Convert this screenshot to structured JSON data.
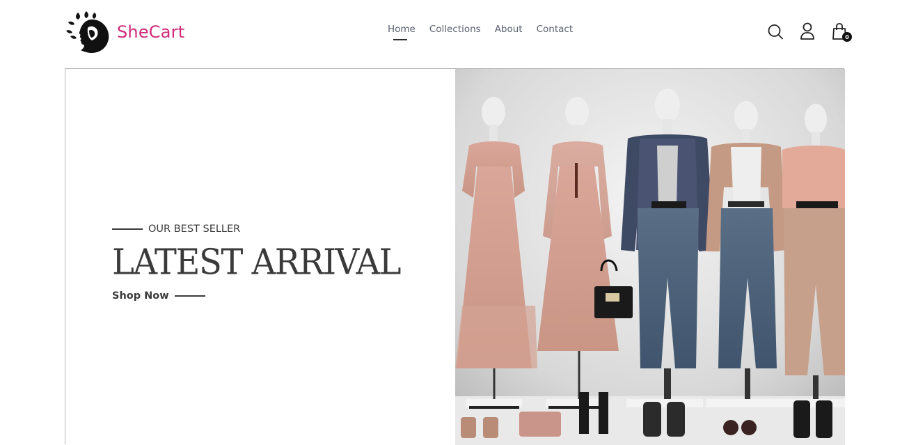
{
  "brand": {
    "name": "SheCart",
    "logo_icon": "woman-silhouette-icon",
    "accent_color": "#d12a78"
  },
  "nav": {
    "links": [
      {
        "label": "Home",
        "active": true
      },
      {
        "label": "Collections",
        "active": false
      },
      {
        "label": "About",
        "active": false
      },
      {
        "label": "Contact",
        "active": false
      }
    ],
    "icons": {
      "search": "search-icon",
      "account": "user-icon",
      "cart": "shopping-bag-icon"
    },
    "cart_count": "0"
  },
  "hero": {
    "eyebrow": "OUR BEST SELLER",
    "title": "LATEST ARRIVAL",
    "cta": "Shop Now",
    "image_alt": "mannequins-fashion-display"
  }
}
